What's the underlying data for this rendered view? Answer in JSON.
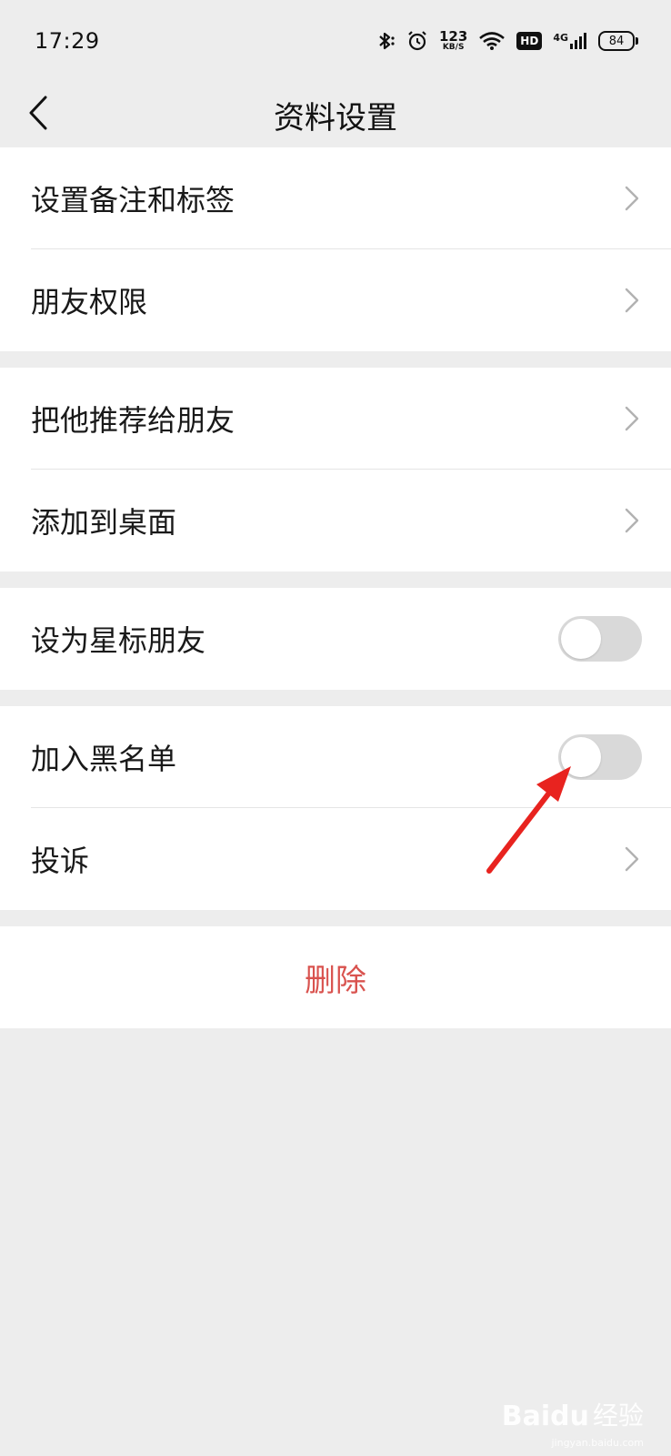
{
  "status_bar": {
    "time": "17:29",
    "net_speed": "123",
    "net_speed_unit": "KB/S",
    "hd": "HD",
    "signal_type": "4G",
    "battery": "84",
    "icons": [
      "bluetooth-icon",
      "alarm-icon",
      "wifi-icon",
      "signal-icon",
      "battery-icon"
    ]
  },
  "nav": {
    "title": "资料设置",
    "back_icon": "chevron-left-icon"
  },
  "groups": [
    {
      "items": [
        {
          "label": "设置备注和标签",
          "control": "chevron"
        },
        {
          "label": "朋友权限",
          "control": "chevron"
        }
      ]
    },
    {
      "items": [
        {
          "label": "把他推荐给朋友",
          "control": "chevron"
        },
        {
          "label": "添加到桌面",
          "control": "chevron"
        }
      ]
    },
    {
      "items": [
        {
          "label": "设为星标朋友",
          "control": "toggle",
          "on": false
        }
      ]
    },
    {
      "items": [
        {
          "label": "加入黑名单",
          "control": "toggle",
          "on": false
        },
        {
          "label": "投诉",
          "control": "chevron"
        }
      ]
    }
  ],
  "delete": {
    "label": "删除",
    "color": "#d9534f"
  },
  "annotation": {
    "type": "red-arrow",
    "points_to": "加入黑名单 toggle",
    "color": "#e8231f"
  },
  "watermark": {
    "brand": "Baidu",
    "brand_cn": "经验",
    "url": "jingyan.baidu.com"
  },
  "colors": {
    "background": "#ededed",
    "row_background": "#ffffff",
    "toggle_off": "#d9d9d9",
    "chevron": "#b2b2b2"
  }
}
